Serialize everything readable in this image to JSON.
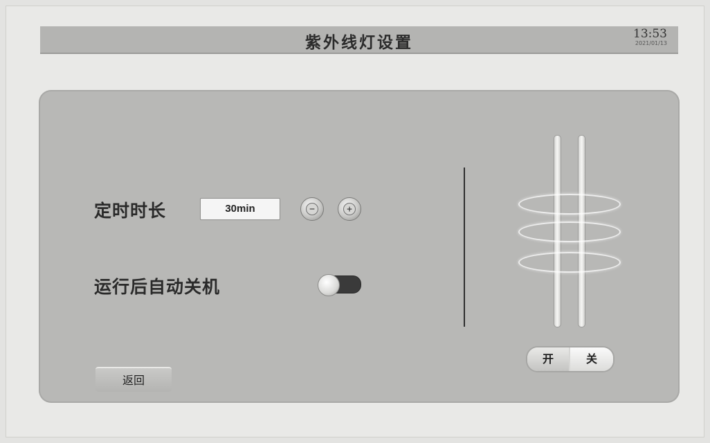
{
  "header": {
    "title": "紫外线灯设置",
    "time": "13:53",
    "date": "2021/01/13"
  },
  "timer": {
    "label": "定时时长",
    "value": "30min",
    "decrease_symbol": "−",
    "increase_symbol": "+"
  },
  "auto_shutdown": {
    "label": "运行后自动关机",
    "enabled": false
  },
  "lamp_switch": {
    "on_label": "开",
    "off_label": "关",
    "state": "off"
  },
  "footer": {
    "back_label": "返回"
  },
  "icons": {
    "minus": "minus-icon",
    "plus": "plus-icon",
    "lamp": "uv-lamp-icon"
  },
  "colors": {
    "panel": "#b8b8b6",
    "header": "#b4b4b2",
    "toggle_track": "#3a3a3a"
  }
}
